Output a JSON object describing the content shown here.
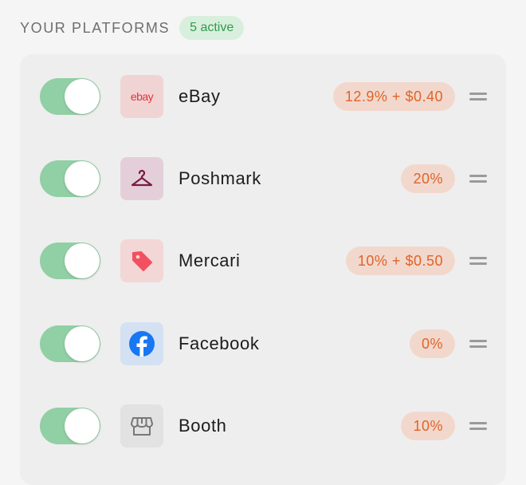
{
  "header": {
    "title": "YOUR PLATFORMS",
    "active_badge": "5 active"
  },
  "colors": {
    "toggle_on": "#91cfa5",
    "fee_text": "#e0632a",
    "fee_bg": "#f2d8cc",
    "badge_text": "#2e9c4e"
  },
  "platforms": [
    {
      "name": "eBay",
      "logo_text": "ebay",
      "icon": "ebay-logo",
      "fee": "12.9% + $0.40",
      "enabled": true
    },
    {
      "name": "Poshmark",
      "icon": "hanger-icon",
      "fee": "20%",
      "enabled": true
    },
    {
      "name": "Mercari",
      "icon": "price-tag-icon",
      "fee": "10% + $0.50",
      "enabled": true
    },
    {
      "name": "Facebook",
      "icon": "facebook-icon",
      "fee": "0%",
      "enabled": true
    },
    {
      "name": "Booth",
      "icon": "storefront-icon",
      "fee": "10%",
      "enabled": true
    }
  ]
}
